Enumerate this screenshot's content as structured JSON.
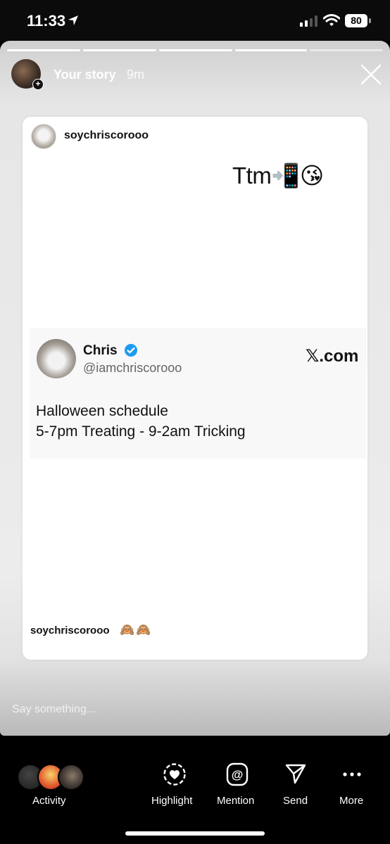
{
  "status_bar": {
    "time": "11:33",
    "battery": "80"
  },
  "story": {
    "username": "Your story",
    "time_ago": "9m",
    "reply_placeholder": "Say something..."
  },
  "shared_post": {
    "username": "soychriscorooo",
    "text": "Ttm",
    "emojis": "📲😘",
    "tweet": {
      "name": "Chris",
      "handle": "@iamchriscorooo",
      "source": "𝕏.com",
      "lines": [
        "Halloween schedule",
        "5-7pm Treating - 9-2am Tricking"
      ]
    },
    "caption_username": "soychriscorooo",
    "caption_emojis": [
      "🙈",
      "🙈"
    ]
  },
  "bottom_bar": {
    "items": [
      {
        "label": "Activity",
        "icon": "activity-avatars"
      },
      {
        "label": "Highlight",
        "icon": "heart-circle-icon"
      },
      {
        "label": "Mention",
        "icon": "at-icon"
      },
      {
        "label": "Send",
        "icon": "paper-plane-icon"
      },
      {
        "label": "More",
        "icon": "more-dots-icon"
      }
    ]
  },
  "colors": {
    "verified": "#1d9bf0",
    "bar_bg": "#000000"
  }
}
